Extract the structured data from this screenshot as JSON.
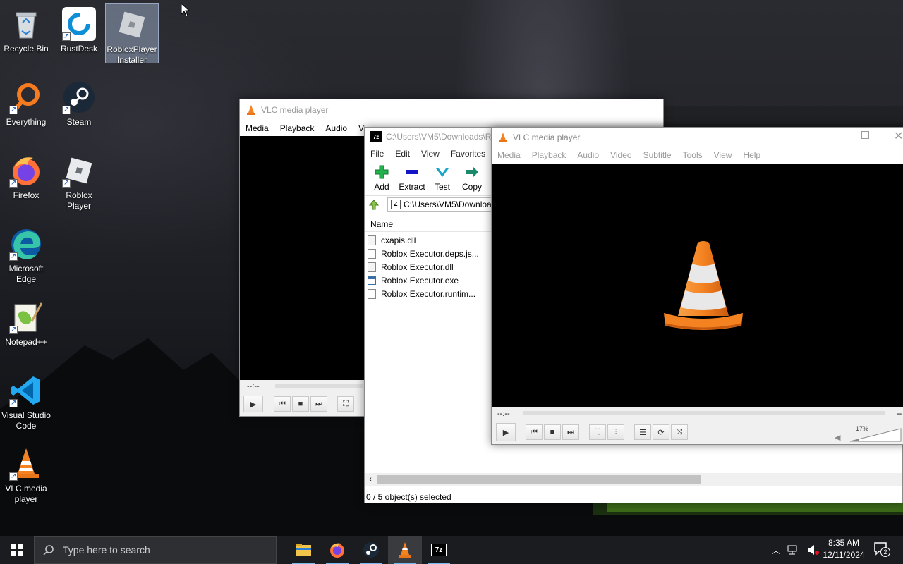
{
  "desktop": {
    "icons": [
      {
        "label": "Recycle Bin",
        "icon": "recycle-bin-icon"
      },
      {
        "label": "RustDesk",
        "icon": "rustdesk-icon"
      },
      {
        "label": "RobloxPlayer Installer",
        "icon": "roblox-installer-icon"
      },
      {
        "label": "Everything",
        "icon": "everything-icon"
      },
      {
        "label": "Steam",
        "icon": "steam-icon"
      },
      {
        "label": "Firefox",
        "icon": "firefox-icon"
      },
      {
        "label": "Roblox Player",
        "icon": "roblox-player-icon"
      },
      {
        "label": "Microsoft Edge",
        "icon": "edge-icon"
      },
      {
        "label": "Notepad++",
        "icon": "notepadpp-icon"
      },
      {
        "label": "Visual Studio Code",
        "icon": "vscode-icon"
      },
      {
        "label": "VLC media player",
        "icon": "vlc-icon"
      }
    ]
  },
  "vlc_back": {
    "title": "VLC media player",
    "menu": [
      "Media",
      "Playback",
      "Audio",
      "Vi"
    ],
    "time": "--:--"
  },
  "sevenzip": {
    "title": "C:\\Users\\VM5\\Downloads\\R",
    "menu": [
      "File",
      "Edit",
      "View",
      "Favorites",
      "To"
    ],
    "toolbar": [
      {
        "label": "Add",
        "icon": "add-icon",
        "color": "#22b14c"
      },
      {
        "label": "Extract",
        "icon": "extract-icon",
        "color": "#1515c8"
      },
      {
        "label": "Test",
        "icon": "test-icon",
        "color": "#19a7c8"
      },
      {
        "label": "Copy",
        "icon": "copy-icon",
        "color": "#1a8a6a"
      }
    ],
    "address": "C:\\Users\\VM5\\Downloa",
    "column_name": "Name",
    "files": [
      {
        "name": "cxapis.dll",
        "icon": "dll-file-icon"
      },
      {
        "name": "Roblox Executor.deps.js...",
        "icon": "json-file-icon"
      },
      {
        "name": "Roblox Executor.dll",
        "icon": "dll-file-icon"
      },
      {
        "name": "Roblox Executor.exe",
        "icon": "exe-file-icon"
      },
      {
        "name": "Roblox Executor.runtim...",
        "icon": "json-file-icon"
      }
    ],
    "status": "0 / 5 object(s) selected"
  },
  "vlc_front": {
    "title": "VLC media player",
    "menu": [
      "Media",
      "Playback",
      "Audio",
      "Video",
      "Subtitle",
      "Tools",
      "View",
      "Help"
    ],
    "time_left": "--:--",
    "time_right": "--",
    "volume": "17%",
    "volume_level": 0.17
  },
  "taskbar": {
    "search_placeholder": "Type here to search",
    "apps": [
      "file-explorer-icon",
      "firefox-icon",
      "steam-icon",
      "vlc-icon",
      "7zip-icon"
    ],
    "time": "8:35 AM",
    "date": "12/11/2024",
    "notifications": "2"
  }
}
